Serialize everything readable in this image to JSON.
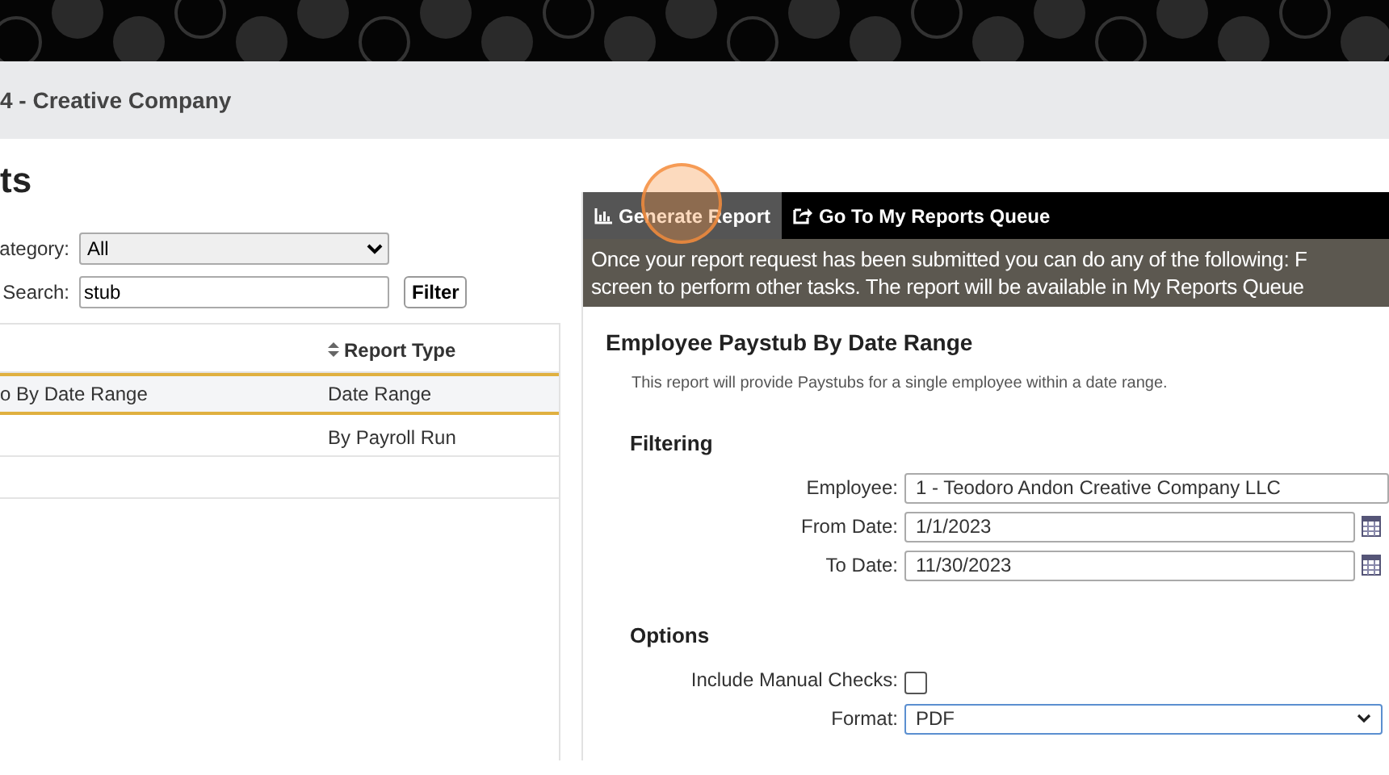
{
  "company_bar": {
    "title": "4 - Creative Company"
  },
  "page_title": "ts",
  "filters": {
    "category": {
      "label": "ategory:",
      "value": "All"
    },
    "search": {
      "label": "Search:",
      "value": "stub"
    },
    "button": "Filter"
  },
  "table": {
    "columns": [
      {
        "sortable": false
      },
      {
        "label": "Report Type",
        "sortable": true
      }
    ],
    "rows": [
      {
        "cells": [
          "o By Date Range",
          "Date Range"
        ],
        "selected": true
      },
      {
        "cells": [
          "",
          "By Payroll Run"
        ],
        "selected": false
      },
      {
        "cells": [
          "",
          ""
        ],
        "selected": false
      }
    ]
  },
  "tabs": [
    {
      "label": "Generate Report",
      "kind": "chart",
      "selected": true
    },
    {
      "label": "Go To My Reports Queue",
      "kind": "share",
      "selected": false
    }
  ],
  "notice": [
    "Once your report request has been submitted you can do any of the following: F",
    "screen to perform other tasks. The report will be available in My Reports Queue"
  ],
  "report": {
    "title": "Employee Paystub By Date Range",
    "description": "This report will provide Paystubs for a single employee within a date range."
  },
  "filtering": {
    "heading": "Filtering",
    "fields": [
      {
        "label": "Employee:",
        "value": "1 - Teodoro Andon Creative Company LLC",
        "kind": "select"
      },
      {
        "label": "From Date:",
        "value": "1/1/2023",
        "kind": "date"
      },
      {
        "label": "To Date:",
        "value": "11/30/2023",
        "kind": "date"
      }
    ]
  },
  "options": {
    "heading": "Options",
    "fields": [
      {
        "label": "Include Manual Checks:",
        "kind": "checkbox",
        "checked": false
      },
      {
        "label": "Format:",
        "value": "PDF",
        "kind": "dropdown"
      }
    ]
  }
}
